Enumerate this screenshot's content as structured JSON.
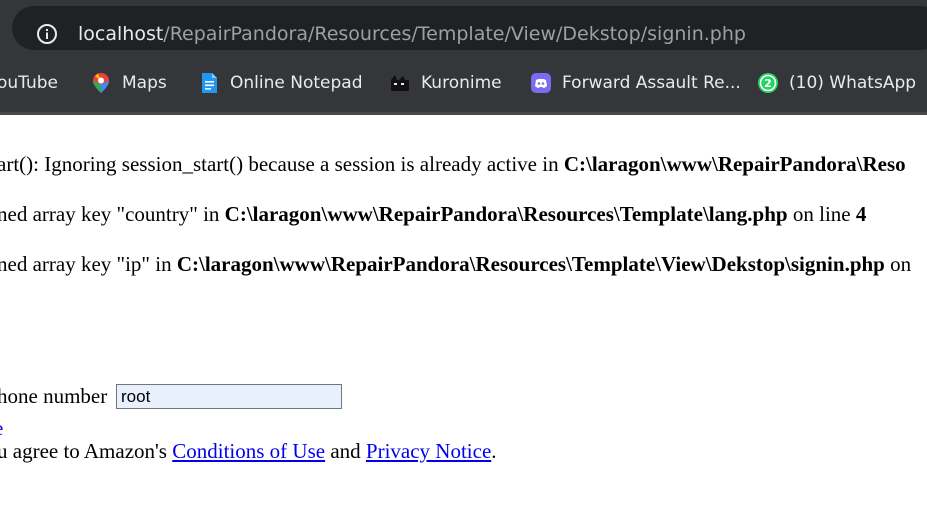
{
  "browser": {
    "url_host": "localhost",
    "url_path": "/RepairPandora/Resources/Template/View/Dekstop/signin.php",
    "info_icon": "info-icon",
    "bookmarks": [
      {
        "label": "ouTube",
        "icon": "youtube-icon"
      },
      {
        "label": "Maps",
        "icon": "maps-pin-icon"
      },
      {
        "label": "Online Notepad",
        "icon": "notepad-icon"
      },
      {
        "label": "Kuronime",
        "icon": "kuronime-icon"
      },
      {
        "label": "Forward Assault Re...",
        "icon": "discord-icon"
      },
      {
        "label": "(10) WhatsApp",
        "icon": "whatsapp-icon"
      }
    ],
    "whatsapp_badge": "2"
  },
  "page": {
    "warning1": {
      "text": "art(): Ignoring session_start() because a session is already active in ",
      "path": "C:\\laragon\\www\\RepairPandora\\Reso"
    },
    "warning2": {
      "text": "ned array key \"country\" in ",
      "path": "C:\\laragon\\www\\RepairPandora\\Resources\\Template\\lang.php",
      "suffix": " on line ",
      "line": "4"
    },
    "warning3": {
      "text": "ned array key \"ip\" in ",
      "path": "C:\\laragon\\www\\RepairPandora\\Resources\\Template\\View\\Dekstop\\signin.php",
      "suffix": " on"
    },
    "phone_label": "hone number",
    "phone_value": "root",
    "agree": {
      "prefix": "u agree to Amazon's ",
      "conditions": "Conditions of Use",
      "and": " and ",
      "privacy": "Privacy Notice",
      "end": "."
    }
  }
}
